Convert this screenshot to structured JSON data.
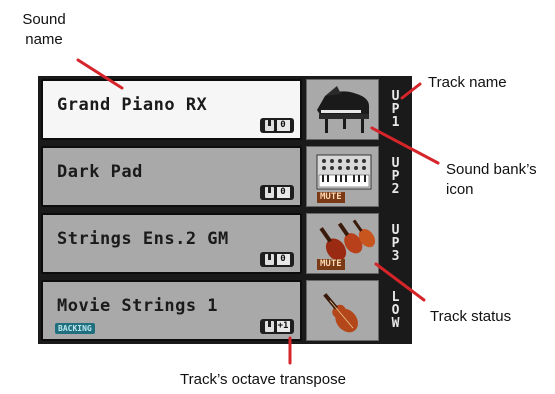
{
  "callouts": {
    "sound_name": [
      "Sound",
      "name"
    ],
    "track_name": "Track name",
    "bank_icon": [
      "Sound bank’s",
      "icon"
    ],
    "track_status": "Track status",
    "octave": "Track’s octave transpose"
  },
  "tracks": [
    {
      "sound": "Grand Piano RX",
      "octave": "0",
      "track": [
        "U",
        "P",
        "1"
      ],
      "icon": "grand-piano-icon",
      "status": "",
      "tag": "",
      "selected": true
    },
    {
      "sound": "Dark Pad",
      "octave": "0",
      "track": [
        "U",
        "P",
        "2"
      ],
      "icon": "synth-keyboard-icon",
      "status": "MUTE",
      "tag": ""
    },
    {
      "sound": "Strings Ens.2 GM",
      "octave": "0",
      "track": [
        "U",
        "P",
        "3"
      ],
      "icon": "strings-icon",
      "status": "MUTE",
      "tag": ""
    },
    {
      "sound": "Movie Strings 1",
      "octave": "+1",
      "track": [
        "L",
        "O",
        "W"
      ],
      "icon": "violin-icon",
      "status": "",
      "tag": "BACKING"
    }
  ],
  "colors": {
    "callout_line": "#d6252a",
    "panel": "#1a1a1a",
    "selected": "#f6f6f6",
    "unselected": "#a9a9a9"
  }
}
